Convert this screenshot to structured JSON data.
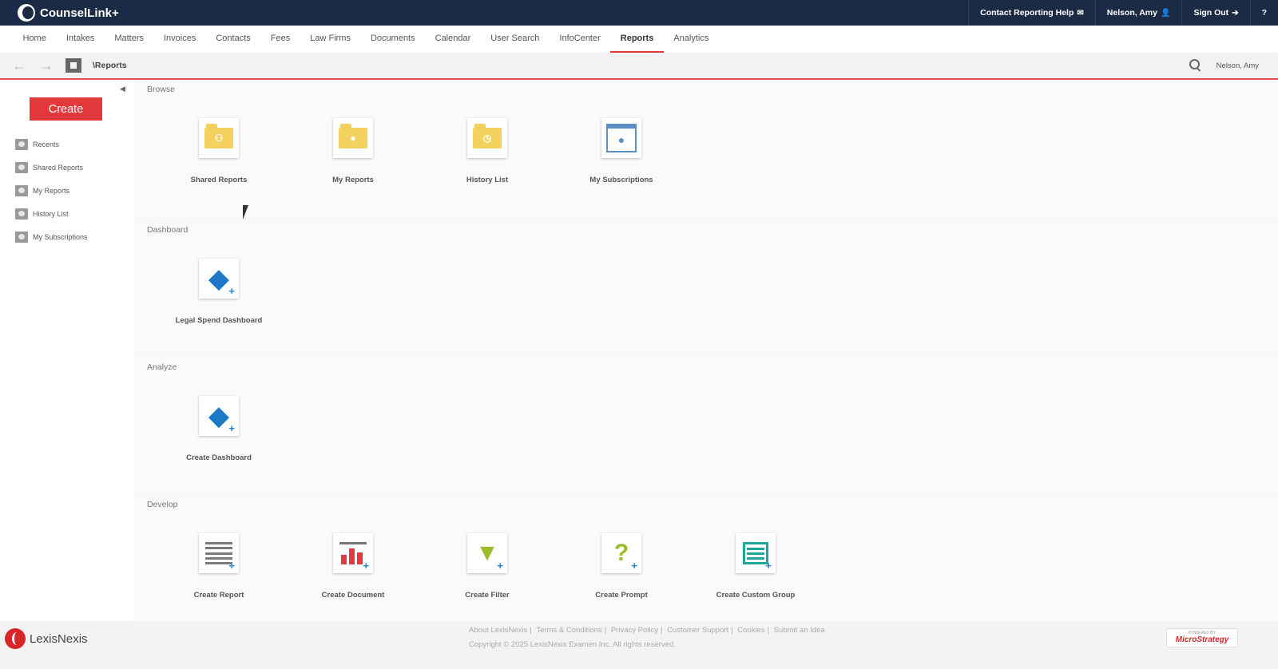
{
  "app": {
    "title": "CounselLink+"
  },
  "topbar": {
    "contact": "Contact Reporting Help",
    "user": "Nelson, Amy",
    "signout": "Sign Out",
    "help": "?"
  },
  "nav": {
    "items": [
      "Home",
      "Intakes",
      "Matters",
      "Invoices",
      "Contacts",
      "Fees",
      "Law Firms",
      "Documents",
      "Calendar",
      "User Search",
      "InfoCenter",
      "Reports",
      "Analytics"
    ],
    "active": "Reports"
  },
  "toolbar": {
    "breadcrumb": "\\Reports",
    "user": "Nelson, Amy"
  },
  "sidebar": {
    "create_label": "Create",
    "items": [
      {
        "label": "Recents",
        "icon": "recents-icon"
      },
      {
        "label": "Shared Reports",
        "icon": "shared-reports-icon"
      },
      {
        "label": "My Reports",
        "icon": "my-reports-icon"
      },
      {
        "label": "History List",
        "icon": "history-icon"
      },
      {
        "label": "My Subscriptions",
        "icon": "subscriptions-icon"
      }
    ]
  },
  "sections": {
    "browse": {
      "title": "Browse",
      "tiles": [
        {
          "label": "Shared Reports",
          "icon": "shared-folder-icon"
        },
        {
          "label": "My Reports",
          "icon": "my-folder-icon"
        },
        {
          "label": "History List",
          "icon": "history-folder-icon"
        },
        {
          "label": "My Subscriptions",
          "icon": "subscriptions-icon"
        }
      ]
    },
    "dashboard": {
      "title": "Dashboard",
      "tiles": [
        {
          "label": "Legal Spend Dashboard",
          "icon": "dashboard-icon"
        }
      ]
    },
    "analyze": {
      "title": "Analyze",
      "tiles": [
        {
          "label": "Create Dashboard",
          "icon": "create-dashboard-icon"
        }
      ]
    },
    "develop": {
      "title": "Develop",
      "tiles": [
        {
          "label": "Create Report",
          "icon": "report-grid-icon"
        },
        {
          "label": "Create Document",
          "icon": "document-chart-icon"
        },
        {
          "label": "Create Filter",
          "icon": "filter-icon"
        },
        {
          "label": "Create Prompt",
          "icon": "prompt-icon"
        },
        {
          "label": "Create Custom Group",
          "icon": "custom-group-icon"
        }
      ]
    }
  },
  "footer": {
    "brand": "LexisNexis",
    "links": [
      "About LexisNexis",
      "Terms & Conditions",
      "Privacy Policy",
      "Customer Support",
      "Cookies",
      "Submit an Idea"
    ],
    "copyright": "Copyright © 2025 LexisNexis Examen Inc. All rights reserved.",
    "powered_small": "POWERED BY",
    "powered_name": "MicroStrategy"
  },
  "colors": {
    "topbar": "#1c2b45",
    "accent": "#e4393c",
    "dashboard": "#1e78c8",
    "develop_green": "#9bbd2a",
    "group_teal": "#1fa69b"
  }
}
